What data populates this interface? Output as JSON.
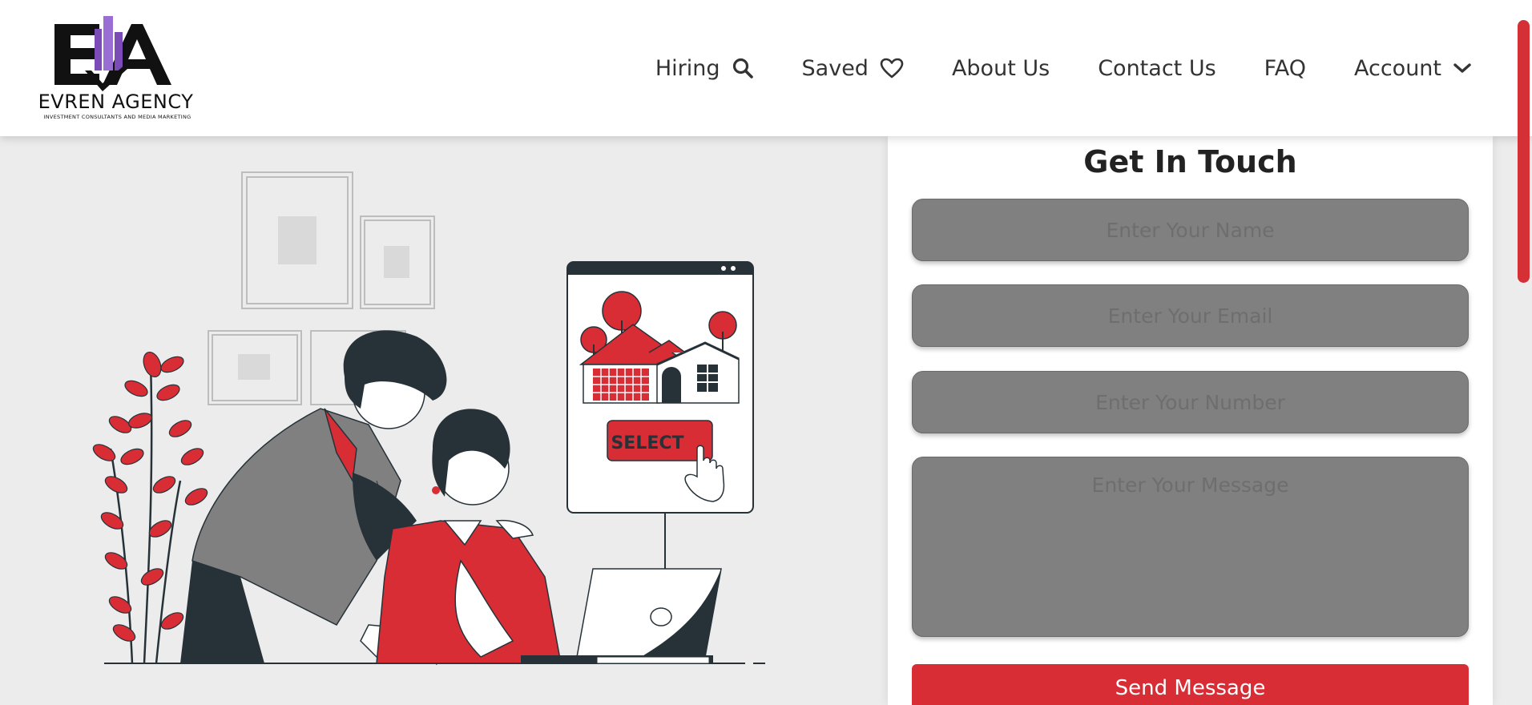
{
  "brand": {
    "monogram": "EA",
    "name": "EVREN AGENCY",
    "tagline": "INVESTMENT CONSULTANTS AND MEDIA MARKETING"
  },
  "nav": {
    "items": [
      {
        "label": "Hiring",
        "icon": "search-icon"
      },
      {
        "label": "Saved",
        "icon": "heart-icon"
      },
      {
        "label": "About Us"
      },
      {
        "label": "Contact Us"
      },
      {
        "label": "FAQ"
      },
      {
        "label": "Account",
        "icon": "chevron-down-icon"
      }
    ]
  },
  "illustration": {
    "button_label": "SELECT"
  },
  "form": {
    "title": "Get In Touch",
    "name_placeholder": "Enter Your Name",
    "email_placeholder": "Enter Your Email",
    "number_placeholder": "Enter Your Number",
    "message_placeholder": "Enter Your Message",
    "submit_label": "Send Message"
  },
  "colors": {
    "accent": "#d92d36",
    "field": "#808080",
    "dark": "#263238",
    "logo_purple": "#7b4bb6"
  }
}
